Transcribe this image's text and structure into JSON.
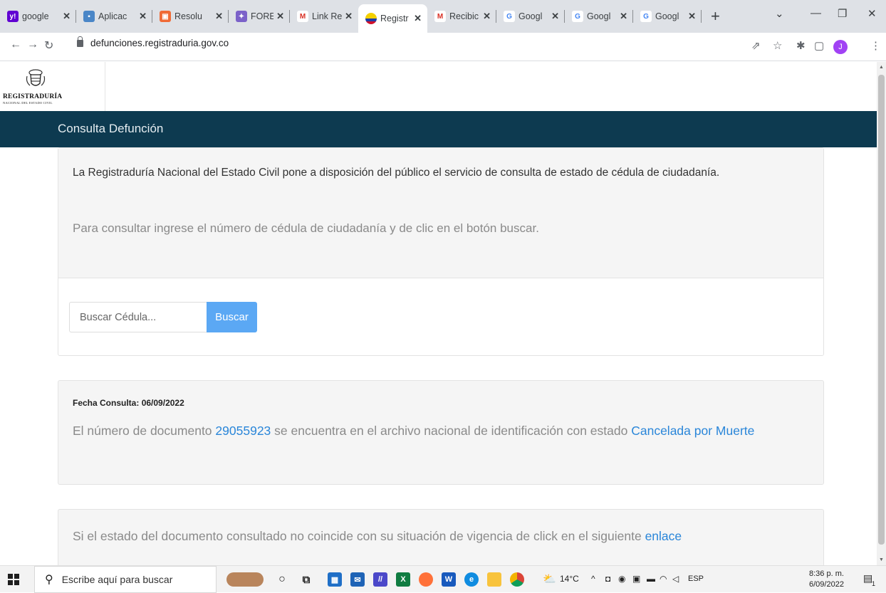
{
  "browser": {
    "tabs": [
      {
        "label": "google",
        "icon": "yahoo-icon",
        "color": "#6001d2"
      },
      {
        "label": "Aplicac",
        "icon": "app-icon",
        "color": "#4a86c7"
      },
      {
        "label": "Resolu",
        "icon": "resolution-icon",
        "color": "#f06a35"
      },
      {
        "label": "FORES",
        "icon": "forest-icon",
        "color": "#7b61c9"
      },
      {
        "label": "Link Re",
        "icon": "gmail-icon",
        "color": "#d93025"
      },
      {
        "label": "Registr",
        "icon": "registraduria-icon",
        "color": "#f4b400",
        "active": true
      },
      {
        "label": "Recibic",
        "icon": "gmail-icon",
        "color": "#d93025"
      },
      {
        "label": "Googl",
        "icon": "google-icon",
        "color": "#4285f4"
      },
      {
        "label": "Googl",
        "icon": "google-icon",
        "color": "#4285f4"
      },
      {
        "label": "Googl",
        "icon": "google-icon",
        "color": "#4285f4"
      }
    ],
    "url": "defunciones.registraduria.gov.co",
    "profile_initial": "J"
  },
  "logo": {
    "title": "REGISTRADURÍA",
    "subtitle": "NACIONAL DEL ESTADO CIVIL"
  },
  "navbar": {
    "brand": "Consulta Defunción",
    "color": "#0d3a50"
  },
  "intro": {
    "text": "La Registraduría Nacional del Estado Civil pone a disposición del público el servicio de consulta de estado de cédula de ciudadanía.",
    "hint": "Para consultar ingrese el número de cédula de ciudadanía y de clic en el botón buscar."
  },
  "search": {
    "placeholder": "Buscar Cédula...",
    "button_label": "Buscar",
    "button_color": "#5ba8f4"
  },
  "result": {
    "date_label": "Fecha Consulta:",
    "date_value": "06/09/2022",
    "text_before": "El número de documento",
    "document_number": "29055923",
    "text_middle": "se encuentra en el archivo nacional de identificación con estado",
    "status": "Cancelada por Muerte",
    "link_color": "#2a86d9"
  },
  "footer_note": {
    "text": "Si el estado del documento consultado no coincide con su situación de vigencia de click en el siguiente",
    "link": "enlace"
  },
  "taskbar": {
    "search_placeholder": "Escribe aquí para buscar",
    "weather": "14°C",
    "language": "ESP",
    "time": "8:36 p. m.",
    "date": "6/09/2022",
    "notification_count": "1"
  }
}
